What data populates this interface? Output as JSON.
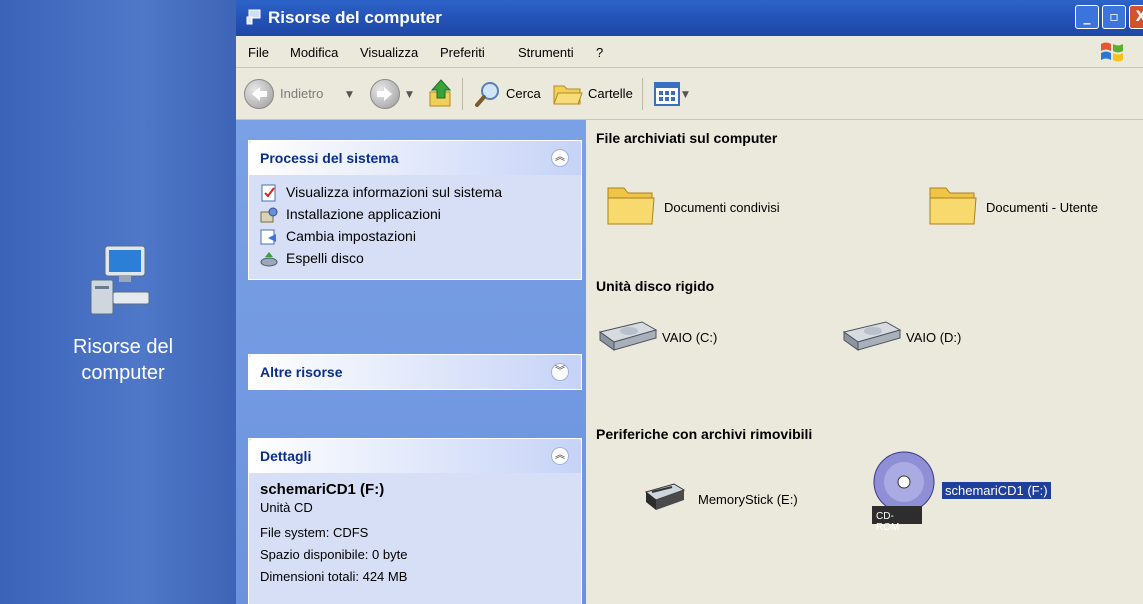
{
  "desktop": {
    "icon_label_line1": "Risorse del",
    "icon_label_line2": "computer"
  },
  "window": {
    "title": "Risorse del computer",
    "controls": {
      "minimize": "_",
      "maximize": "▫",
      "close": "X"
    }
  },
  "menu": {
    "items": [
      "File",
      "Modifica",
      "Visualizza",
      "Preferiti",
      "Strumenti",
      "?"
    ]
  },
  "toolbar": {
    "back_label": "Indietro",
    "search_label": "Cerca",
    "folders_label": "Cartelle"
  },
  "taskpane": {
    "system": {
      "title": "Processi del sistema",
      "items": [
        {
          "label": "Visualizza informazioni sul sistema",
          "icon": "info-icon"
        },
        {
          "label": "Installazione applicazioni",
          "icon": "install-icon"
        },
        {
          "label": "Cambia impostazioni",
          "icon": "settings-icon"
        },
        {
          "label": "Espelli disco",
          "icon": "eject-icon"
        }
      ]
    },
    "other": {
      "title": "Altre risorse"
    },
    "details": {
      "title": "Dettagli",
      "name": "schemariCD1 (F:)",
      "type": "Unità CD",
      "filesystem": "File system: CDFS",
      "free": "Spazio disponibile: 0 byte",
      "total": "Dimensioni totali: 424 MB"
    }
  },
  "content": {
    "groups": {
      "files": {
        "title": "File archiviati sul computer",
        "items": [
          "Documenti condivisi",
          "Documenti - Utente"
        ]
      },
      "disks": {
        "title": "Unità disco rigido",
        "items": [
          "VAIO (C:)",
          "VAIO (D:)"
        ]
      },
      "removable": {
        "title": "Periferiche con archivi rimovibili",
        "items": [
          "MemoryStick (E:)",
          "schemariCD1 (F:)"
        ],
        "cd_badge": "CD-ROM"
      }
    }
  },
  "colors": {
    "titlebar": "#2453b8",
    "taskpane": "#6b93dd",
    "selection": "#1e3f9b",
    "heading_blue": "#0b2e8a"
  }
}
